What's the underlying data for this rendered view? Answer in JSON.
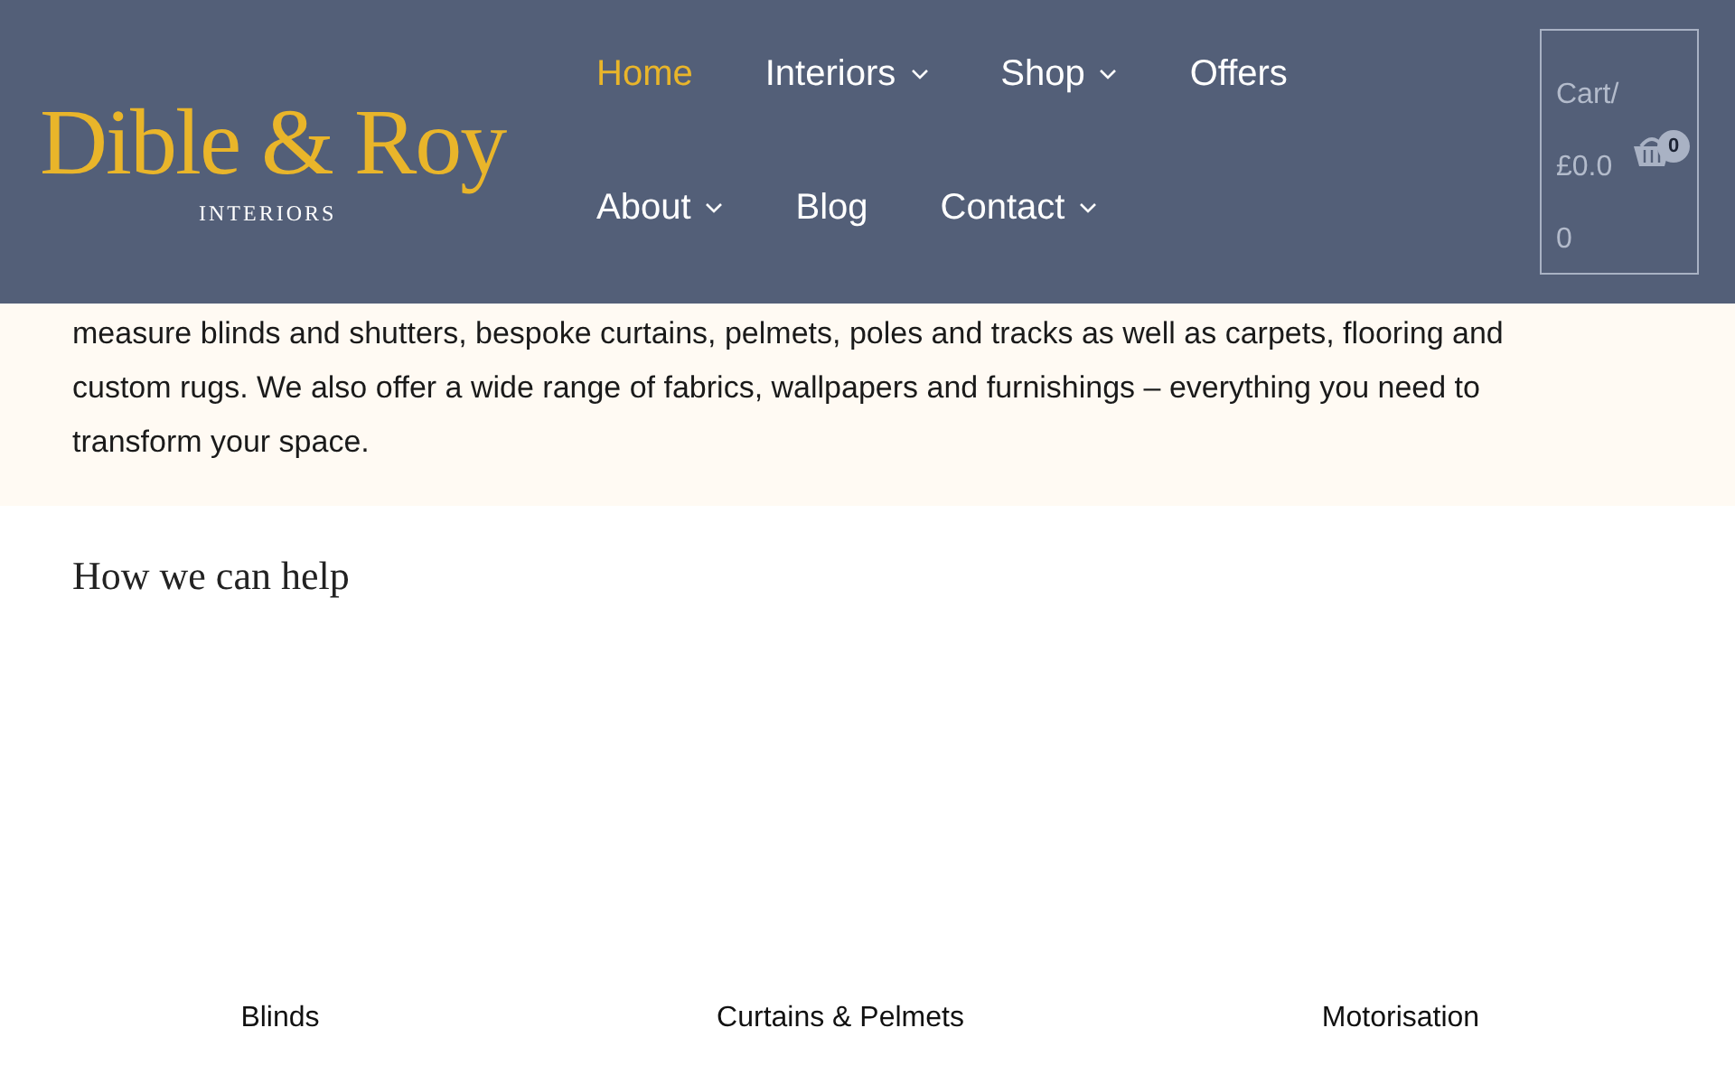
{
  "logo": {
    "name": "Dible & Roy",
    "tagline": "INTERIORS"
  },
  "nav": [
    {
      "label": "Home",
      "selected": true,
      "dropdown": false
    },
    {
      "label": "Interiors",
      "selected": false,
      "dropdown": true
    },
    {
      "label": "Shop",
      "selected": false,
      "dropdown": true
    },
    {
      "label": "Offers",
      "selected": false,
      "dropdown": false
    },
    {
      "label": "About",
      "selected": false,
      "dropdown": true
    },
    {
      "label": "Blog",
      "selected": false,
      "dropdown": false
    },
    {
      "label": "Contact",
      "selected": false,
      "dropdown": true
    }
  ],
  "cart": {
    "label": "Cart/",
    "total": "£0.0",
    "count_line": "0",
    "badge": "0"
  },
  "intro": {
    "text": "measure blinds and shutters, bespoke curtains, pelmets, poles and tracks as well as carpets, flooring and custom rugs. We also offer a wide range of fabrics, wallpapers and furnishings – everything you need to transform your space."
  },
  "section": {
    "title": "How we can help",
    "services": [
      {
        "label": "Blinds"
      },
      {
        "label": "Curtains & Pelmets"
      },
      {
        "label": "Motorisation"
      }
    ]
  }
}
